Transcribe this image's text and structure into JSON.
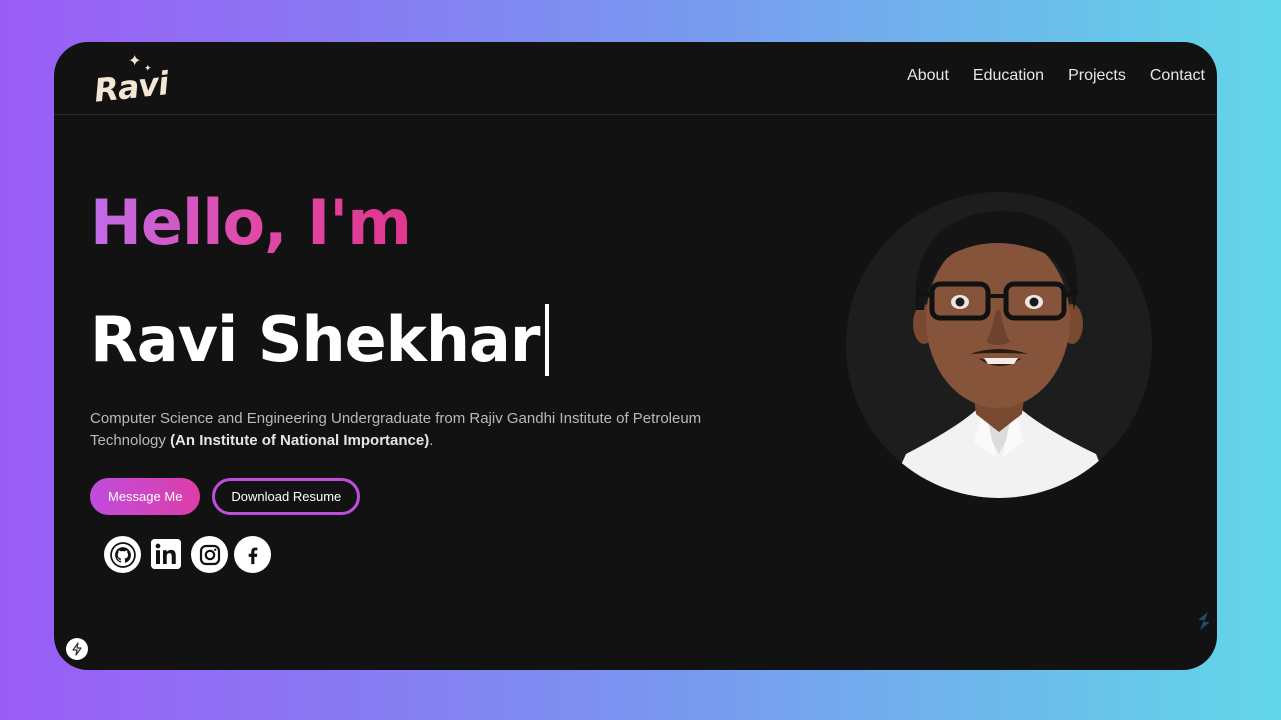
{
  "logo": {
    "text": "Ravi"
  },
  "nav": {
    "items": [
      {
        "label": "About"
      },
      {
        "label": "Education"
      },
      {
        "label": "Projects"
      },
      {
        "label": "Contact"
      }
    ]
  },
  "hero": {
    "greeting": "Hello, I'm",
    "name": "Ravi Shekhar",
    "description": "Computer Science and Engineering Undergraduate from Rajiv Gandhi Institute of Petroleum Technology ",
    "description_bold": "(An Institute of National Importance)",
    "description_end": ".",
    "primary_button": "Message Me",
    "secondary_button": "Download Resume"
  },
  "socials": [
    {
      "icon": "github-icon"
    },
    {
      "icon": "linkedin-icon"
    },
    {
      "icon": "instagram-icon"
    },
    {
      "icon": "facebook-icon"
    }
  ],
  "colors": {
    "accent_start": "#c04ddc",
    "accent_end": "#dc3ea8",
    "background": "#121212"
  }
}
